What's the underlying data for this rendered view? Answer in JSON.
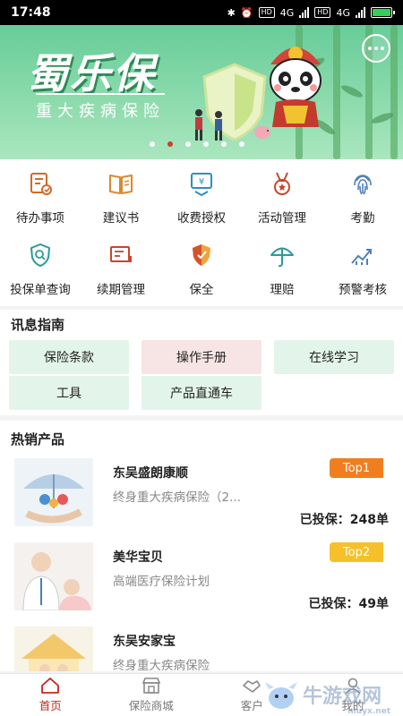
{
  "status_bar": {
    "time": "17:48",
    "network": "4G",
    "hd": "HD"
  },
  "banner": {
    "title": "蜀乐保",
    "subtitle": "重大疾病保险",
    "dot_count": 6,
    "active_dot": 1
  },
  "menu": {
    "items": [
      {
        "label": "待办事项",
        "icon": "todo-icon"
      },
      {
        "label": "建议书",
        "icon": "book-icon"
      },
      {
        "label": "收费授权",
        "icon": "payment-auth-icon"
      },
      {
        "label": "活动管理",
        "icon": "medal-icon"
      },
      {
        "label": "考勤",
        "icon": "fingerprint-icon"
      },
      {
        "label": "投保单查询",
        "icon": "policy-search-icon"
      },
      {
        "label": "续期管理",
        "icon": "renewal-icon"
      },
      {
        "label": "保全",
        "icon": "shield-icon"
      },
      {
        "label": "理赔",
        "icon": "umbrella-icon"
      },
      {
        "label": "预警考核",
        "icon": "trend-icon"
      }
    ]
  },
  "guide": {
    "title": "讯息指南",
    "chips": [
      "保险条款",
      "操作手册",
      "在线学习",
      "工具",
      "产品直通车"
    ]
  },
  "hot": {
    "title": "热销产品",
    "products": [
      {
        "name": "东吴盛朗康顺",
        "desc": "终身重大疾病保险（2...",
        "badge": "Top1",
        "count": "已投保：248单"
      },
      {
        "name": "美华宝贝",
        "desc": "高端医疗保险计划",
        "badge": "Top2",
        "count": "已投保：49单"
      },
      {
        "name": "东吴安家宝",
        "desc": "终身重大疾病保险",
        "badge": "",
        "count": ""
      }
    ]
  },
  "tabbar": {
    "tabs": [
      {
        "label": "首页",
        "icon": "home-icon"
      },
      {
        "label": "保险商城",
        "icon": "store-icon"
      },
      {
        "label": "客户",
        "icon": "handshake-icon"
      },
      {
        "label": "我的",
        "icon": "user-icon"
      }
    ],
    "active": 0
  },
  "watermark": {
    "text": "牛游戏网",
    "url": "niuyx.net"
  },
  "colors": {
    "accent": "#c2281b",
    "banner_green": "#67cc99",
    "chip_green": "#e3f5ea",
    "chip_pink": "#f7e4e4",
    "top1": "#f07e1f",
    "top2": "#f5c02a"
  }
}
